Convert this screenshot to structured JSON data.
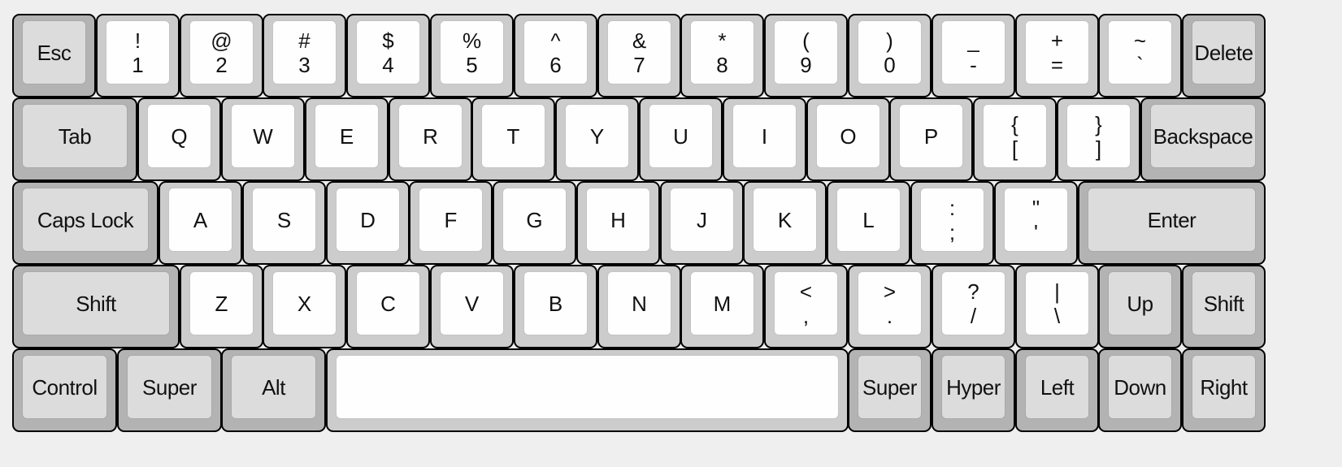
{
  "keyboard": {
    "rows": [
      [
        {
          "id": "esc",
          "label": "Esc",
          "type": "mod",
          "w": 1
        },
        {
          "id": "1",
          "top": "!",
          "bottom": "1",
          "type": "alpha",
          "w": 1
        },
        {
          "id": "2",
          "top": "@",
          "bottom": "2",
          "type": "alpha",
          "w": 1
        },
        {
          "id": "3",
          "top": "#",
          "bottom": "3",
          "type": "alpha",
          "w": 1
        },
        {
          "id": "4",
          "top": "$",
          "bottom": "4",
          "type": "alpha",
          "w": 1
        },
        {
          "id": "5",
          "top": "%",
          "bottom": "5",
          "type": "alpha",
          "w": 1
        },
        {
          "id": "6",
          "top": "^",
          "bottom": "6",
          "type": "alpha",
          "w": 1
        },
        {
          "id": "7",
          "top": "&",
          "bottom": "7",
          "type": "alpha",
          "w": 1
        },
        {
          "id": "8",
          "top": "*",
          "bottom": "8",
          "type": "alpha",
          "w": 1
        },
        {
          "id": "9",
          "top": "(",
          "bottom": "9",
          "type": "alpha",
          "w": 1
        },
        {
          "id": "0",
          "top": ")",
          "bottom": "0",
          "type": "alpha",
          "w": 1
        },
        {
          "id": "minus",
          "top": "_",
          "bottom": "-",
          "type": "alpha",
          "w": 1
        },
        {
          "id": "equals",
          "top": "+",
          "bottom": "=",
          "type": "alpha",
          "w": 1
        },
        {
          "id": "grave",
          "top": "~",
          "bottom": "`",
          "type": "alpha",
          "w": 1
        },
        {
          "id": "delete",
          "label": "Delete",
          "type": "mod",
          "w": 1
        }
      ],
      [
        {
          "id": "tab",
          "label": "Tab",
          "type": "mod",
          "w": 1.5
        },
        {
          "id": "q",
          "label": "Q",
          "type": "alpha",
          "w": 1
        },
        {
          "id": "w",
          "label": "W",
          "type": "alpha",
          "w": 1
        },
        {
          "id": "e",
          "label": "E",
          "type": "alpha",
          "w": 1
        },
        {
          "id": "r",
          "label": "R",
          "type": "alpha",
          "w": 1
        },
        {
          "id": "t",
          "label": "T",
          "type": "alpha",
          "w": 1
        },
        {
          "id": "y",
          "label": "Y",
          "type": "alpha",
          "w": 1
        },
        {
          "id": "u",
          "label": "U",
          "type": "alpha",
          "w": 1
        },
        {
          "id": "i",
          "label": "I",
          "type": "alpha",
          "w": 1
        },
        {
          "id": "o",
          "label": "O",
          "type": "alpha",
          "w": 1
        },
        {
          "id": "p",
          "label": "P",
          "type": "alpha",
          "w": 1
        },
        {
          "id": "lbracket",
          "top": "{",
          "bottom": "[",
          "type": "alpha",
          "w": 1
        },
        {
          "id": "rbracket",
          "top": "}",
          "bottom": "]",
          "type": "alpha",
          "w": 1
        },
        {
          "id": "backspace",
          "label": "Backspace",
          "type": "mod",
          "w": 1.5
        }
      ],
      [
        {
          "id": "capslock",
          "label": "Caps Lock",
          "type": "mod",
          "w": 1.75
        },
        {
          "id": "a",
          "label": "A",
          "type": "alpha",
          "w": 1
        },
        {
          "id": "s",
          "label": "S",
          "type": "alpha",
          "w": 1
        },
        {
          "id": "d",
          "label": "D",
          "type": "alpha",
          "w": 1
        },
        {
          "id": "f",
          "label": "F",
          "type": "alpha",
          "w": 1
        },
        {
          "id": "g",
          "label": "G",
          "type": "alpha",
          "w": 1
        },
        {
          "id": "h",
          "label": "H",
          "type": "alpha",
          "w": 1
        },
        {
          "id": "j",
          "label": "J",
          "type": "alpha",
          "w": 1
        },
        {
          "id": "k",
          "label": "K",
          "type": "alpha",
          "w": 1
        },
        {
          "id": "l",
          "label": "L",
          "type": "alpha",
          "w": 1
        },
        {
          "id": "semicolon",
          "top": ":",
          "bottom": ";",
          "type": "alpha",
          "w": 1
        },
        {
          "id": "quote",
          "top": "\"",
          "bottom": "'",
          "type": "alpha",
          "w": 1
        },
        {
          "id": "enter",
          "label": "Enter",
          "type": "mod",
          "w": 2.25
        }
      ],
      [
        {
          "id": "lshift",
          "label": "Shift",
          "type": "mod",
          "w": 2
        },
        {
          "id": "z",
          "label": "Z",
          "type": "alpha",
          "w": 1
        },
        {
          "id": "x",
          "label": "X",
          "type": "alpha",
          "w": 1
        },
        {
          "id": "c",
          "label": "C",
          "type": "alpha",
          "w": 1
        },
        {
          "id": "v",
          "label": "V",
          "type": "alpha",
          "w": 1
        },
        {
          "id": "b",
          "label": "B",
          "type": "alpha",
          "w": 1
        },
        {
          "id": "n",
          "label": "N",
          "type": "alpha",
          "w": 1
        },
        {
          "id": "m",
          "label": "M",
          "type": "alpha",
          "w": 1
        },
        {
          "id": "comma",
          "top": "<",
          "bottom": ",",
          "type": "alpha",
          "w": 1
        },
        {
          "id": "period",
          "top": ">",
          "bottom": ".",
          "type": "alpha",
          "w": 1
        },
        {
          "id": "slash",
          "top": "?",
          "bottom": "/",
          "type": "alpha",
          "w": 1
        },
        {
          "id": "backslash",
          "top": "|",
          "bottom": "\\",
          "type": "alpha",
          "w": 1
        },
        {
          "id": "up",
          "label": "Up",
          "type": "mod",
          "w": 1
        },
        {
          "id": "rshift",
          "label": "Shift",
          "type": "mod",
          "w": 1
        }
      ],
      [
        {
          "id": "lcontrol",
          "label": "Control",
          "type": "mod",
          "w": 1.25
        },
        {
          "id": "lsuper",
          "label": "Super",
          "type": "mod",
          "w": 1.25
        },
        {
          "id": "lalt",
          "label": "Alt",
          "type": "mod",
          "w": 1.25
        },
        {
          "id": "space",
          "label": "",
          "type": "alpha",
          "w": 6.25
        },
        {
          "id": "rsuper",
          "label": "Super",
          "type": "mod",
          "w": 1
        },
        {
          "id": "hyper",
          "label": "Hyper",
          "type": "mod",
          "w": 1
        },
        {
          "id": "left",
          "label": "Left",
          "type": "mod",
          "w": 1
        },
        {
          "id": "down",
          "label": "Down",
          "type": "mod",
          "w": 1
        },
        {
          "id": "right",
          "label": "Right",
          "type": "mod",
          "w": 1
        }
      ]
    ]
  }
}
